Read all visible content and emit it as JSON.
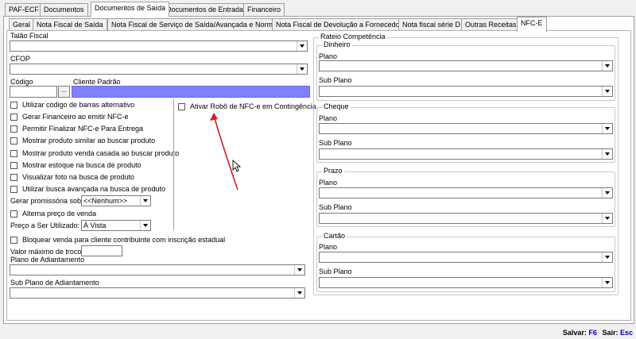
{
  "top_tabs": [
    "PAF-ECF",
    "Documentos",
    "Documentos de Saída",
    "Documentos de Entrada",
    "Financeiro"
  ],
  "sub_tabs": [
    "Geral",
    "Nota Fiscal de Saída",
    "Nota Fiscal de Serviço de Saída/Avançada e Normal",
    "Nota Fiscal de Devolução a Fornecedor",
    "Nota fiscal série D",
    "Outras Receitas",
    "NFC-E"
  ],
  "left": {
    "talao_label": "Talão Fiscal",
    "talao_value": "",
    "cfop_label": "CFOP",
    "cfop_value": "",
    "codigo_label": "Código",
    "codigo_value": "",
    "lookup_label": "...",
    "cliente_label": "Cliente Padrão",
    "cliente_value": "",
    "checks": [
      "Utilizar código de barras alternativo",
      "Gerar Financeiro ao emitir NFC-e",
      "Permitir Finalizar NFC-e Para Entrega",
      "Mostrar produto similar ao buscar produto",
      "Mostrar produto venda casada ao buscar produto",
      "Mostrar estoque na busca de produto",
      "Visualizar foto na busca de produto",
      "Utilizar busca avançada na busca de produto"
    ],
    "promissoria_label": "Gerar promissória sobre:",
    "promissoria_value": "<<Nenhum>>",
    "alterna_label": "Alterna preço de venda",
    "preco_label": "Preço a Ser Utilizado:",
    "preco_value": "À Vista",
    "robo_label": "Ativar Robô de NFC-e em Contingência",
    "bloquear_label": "Bloquear venda para cliente contribuinte com inscrição estadual",
    "troco_label": "Valor máximo de troco",
    "troco_value": "",
    "adiant_label": "Plano de Adiantamento",
    "adiant_value": "",
    "subadiant_label": "Sub Plano de Adiantamento",
    "subadiant_value": ""
  },
  "rateio": {
    "title": "Rateio Competência",
    "groups": [
      {
        "title": "Dinheiro",
        "plano_label": "Plano",
        "subplano_label": "Sub Plano"
      },
      {
        "title": "Cheque",
        "plano_label": "Plano",
        "subplano_label": "Sub Plano"
      },
      {
        "title": "Prazo",
        "plano_label": "Plano",
        "subplano_label": "Sub Plano"
      },
      {
        "title": "Cartão",
        "plano_label": "Plano",
        "subplano_label": "Sub Plano"
      }
    ]
  },
  "status": {
    "salvar_label": "Salvar:",
    "salvar_key": "F6",
    "sair_label": "Sair:",
    "sair_key": "Esc"
  },
  "colors": {
    "selection": "#8080ff",
    "annotation_arrow": "#d81c1c",
    "shortcut": "#0000c0"
  }
}
